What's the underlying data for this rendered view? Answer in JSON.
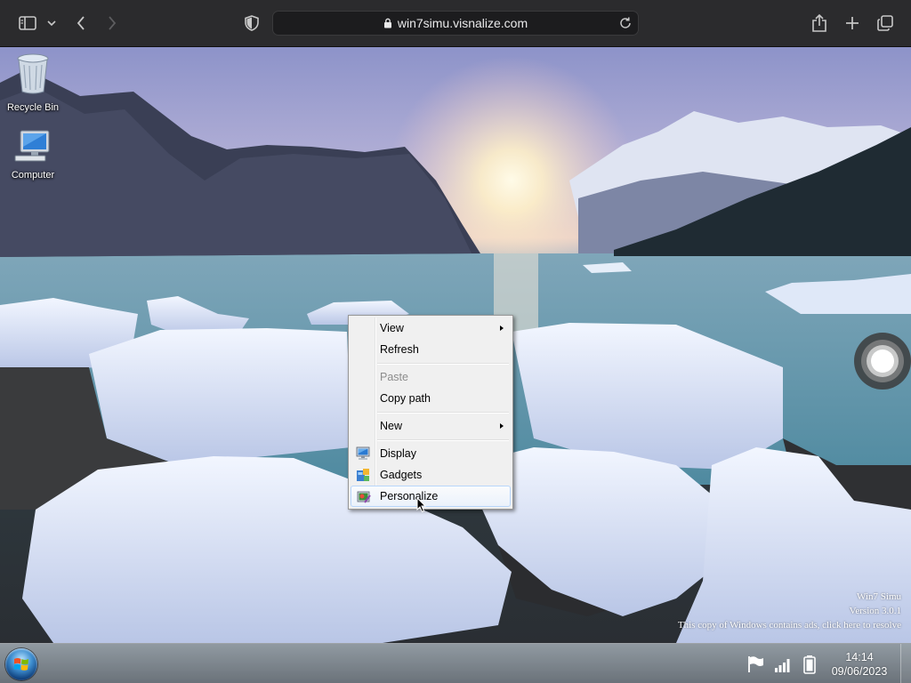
{
  "browser": {
    "url": "win7simu.visnalize.com",
    "icons": [
      "sidebar-icon",
      "chevron-down-icon",
      "back-icon",
      "forward-icon",
      "shield-icon",
      "lock-icon",
      "reload-icon",
      "share-icon",
      "plus-icon",
      "tabs-icon"
    ]
  },
  "desktop": {
    "icons": [
      {
        "label": "Recycle Bin",
        "icon": "recycle-bin-icon"
      },
      {
        "label": "Computer",
        "icon": "computer-icon"
      }
    ],
    "watermark": {
      "line1": "Win7 Simu",
      "line2": "Version 3.0.1",
      "line3": "This copy of Windows contains ads, click here to resolve"
    }
  },
  "context_menu": {
    "items": [
      {
        "label": "View",
        "submenu": true
      },
      {
        "label": "Refresh"
      },
      {
        "label": "Paste",
        "disabled": true
      },
      {
        "label": "Copy path"
      },
      {
        "label": "New",
        "submenu": true
      },
      {
        "label": "Display",
        "icon": "display-icon"
      },
      {
        "label": "Gadgets",
        "icon": "gadgets-icon"
      },
      {
        "label": "Personalize",
        "icon": "personalize-icon",
        "highlighted": true
      }
    ]
  },
  "taskbar": {
    "time": "14:14",
    "date": "09/06/2023",
    "tray_icons": [
      "action-center-flag-icon",
      "signal-icon",
      "battery-icon"
    ]
  },
  "colors": {
    "menu_bg": "#f0f0f0",
    "menu_highlight_border": "#b8d6fb",
    "browser_bar": "#2b2b2d"
  }
}
